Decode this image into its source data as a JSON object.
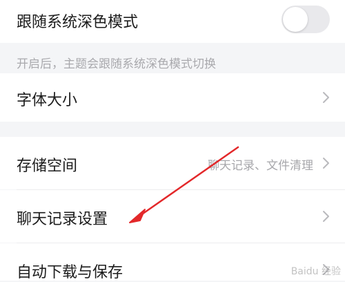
{
  "settings": {
    "follow_dark_mode": {
      "label": "跟随系统深色模式",
      "enabled": false
    },
    "follow_dark_mode_hint": "开启后，主题会跟随系统深色模式切换",
    "font_size": {
      "label": "字体大小"
    },
    "storage": {
      "label": "存储空间",
      "value": "聊天记录、文件清理"
    },
    "chat_history": {
      "label": "聊天记录设置"
    },
    "auto_download": {
      "label": "自动下载与保存"
    }
  },
  "watermark": {
    "text": "Baidu 经验"
  },
  "colors": {
    "annotation_arrow": "#e3282a",
    "page_background": "#f4f5f7",
    "row_background": "#ffffff"
  },
  "icons": {
    "chevron": "chevron-right-icon"
  }
}
